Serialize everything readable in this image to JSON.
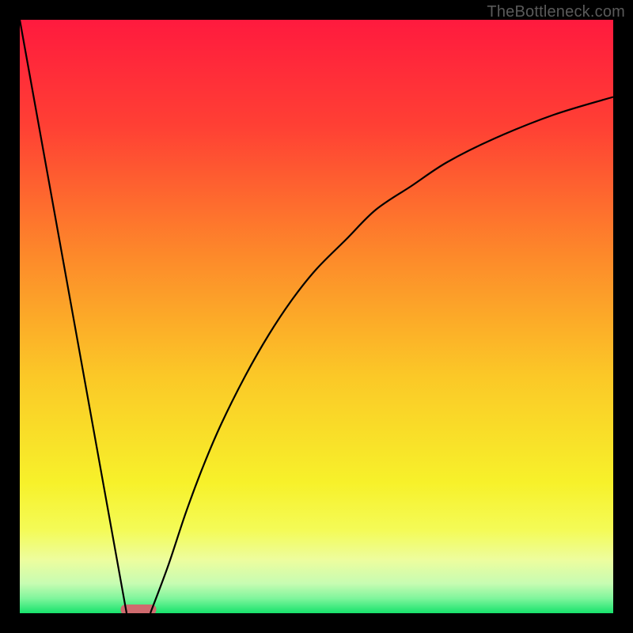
{
  "watermark": "TheBottleneck.com",
  "chart_data": {
    "type": "line",
    "title": "",
    "xlabel": "",
    "ylabel": "",
    "xlim": [
      0,
      100
    ],
    "ylim": [
      0,
      100
    ],
    "grid": false,
    "legend": false,
    "annotations": [],
    "series": [
      {
        "name": "left-segment",
        "x": [
          0,
          18
        ],
        "values": [
          100,
          0
        ]
      },
      {
        "name": "right-segment",
        "x": [
          22,
          25,
          28,
          31,
          34,
          38,
          42,
          46,
          50,
          55,
          60,
          66,
          72,
          80,
          90,
          100
        ],
        "values": [
          0,
          8,
          17,
          25,
          32,
          40,
          47,
          53,
          58,
          63,
          68,
          72,
          76,
          80,
          84,
          87
        ]
      }
    ],
    "marker": {
      "name": "bottom-marker",
      "x_center": 20,
      "y": 0,
      "width_frac": 0.06,
      "fill": "#cf6a6e"
    },
    "gradient_stops": [
      {
        "offset": 0.0,
        "color": "#ff1a3e"
      },
      {
        "offset": 0.18,
        "color": "#ff4034"
      },
      {
        "offset": 0.4,
        "color": "#fd8a2a"
      },
      {
        "offset": 0.6,
        "color": "#fbc827"
      },
      {
        "offset": 0.78,
        "color": "#f7f12a"
      },
      {
        "offset": 0.86,
        "color": "#f4fb57"
      },
      {
        "offset": 0.91,
        "color": "#edfd9e"
      },
      {
        "offset": 0.95,
        "color": "#c7fcb2"
      },
      {
        "offset": 0.975,
        "color": "#7ff59c"
      },
      {
        "offset": 1.0,
        "color": "#17e36c"
      }
    ]
  }
}
